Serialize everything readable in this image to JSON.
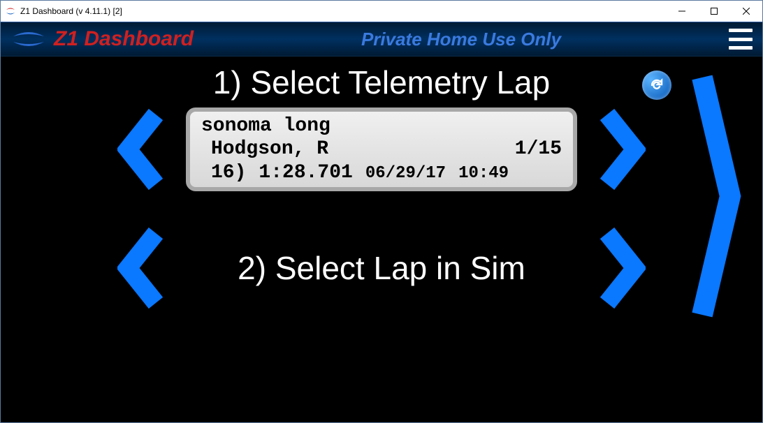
{
  "window": {
    "title": "Z1 Dashboard (v 4.11.1) [2]"
  },
  "header": {
    "app_name": "Z1 Dashboard",
    "subtitle": "Private Home Use Only"
  },
  "section1": {
    "title": "1) Select Telemetry Lap",
    "lap": {
      "track": "sonoma long",
      "driver": "Hodgson, R",
      "index": "1/15",
      "lap_num": "16)",
      "lap_time": "1:28.701",
      "date": "06/29/17",
      "time": "10:49"
    }
  },
  "section2": {
    "title": "2) Select Lap in Sim"
  }
}
